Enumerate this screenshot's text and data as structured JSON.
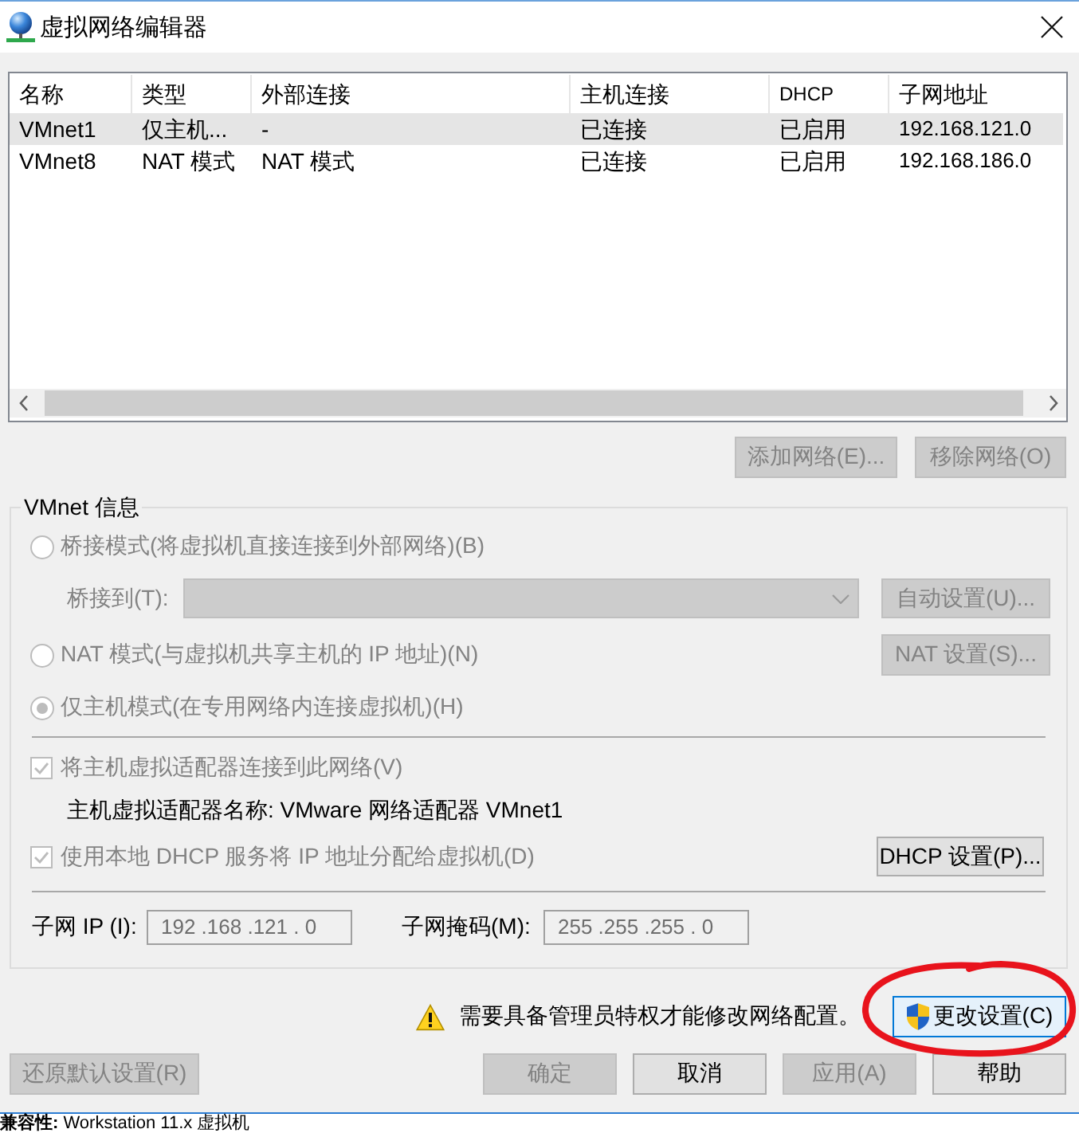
{
  "window": {
    "title": "虚拟网络编辑器"
  },
  "network_table": {
    "columns": [
      "名称",
      "类型",
      "外部连接",
      "主机连接",
      "DHCP",
      "子网地址"
    ],
    "rows": [
      {
        "cells": [
          "VMnet1",
          "仅主机...",
          "-",
          "已连接",
          "已启用",
          "192.168.121.0"
        ],
        "selected": true
      },
      {
        "cells": [
          "VMnet8",
          "NAT 模式",
          "NAT 模式",
          "已连接",
          "已启用",
          "192.168.186.0"
        ],
        "selected": false
      }
    ]
  },
  "table_buttons": [
    {
      "label": "添加网络(E)...",
      "disabled": true
    },
    {
      "label": "移除网络(O)",
      "disabled": true
    }
  ],
  "vmnet_info": {
    "title": "VMnet 信息",
    "modes": [
      {
        "label": "桥接模式(将虚拟机直接连接到外部网络)(B)",
        "selected": false,
        "disabled": true,
        "bridge_to": {
          "label": "桥接到(T):",
          "disabled": true,
          "button": {
            "label": "自动设置(U)...",
            "disabled": true
          }
        }
      },
      {
        "label": "NAT 模式(与虚拟机共享主机的 IP 地址)(N)",
        "selected": false,
        "disabled": true,
        "button": {
          "label": "NAT 设置(S)...",
          "disabled": true
        }
      },
      {
        "label": "仅主机模式(在专用网络内连接虚拟机)(H)",
        "selected": true,
        "disabled": true
      }
    ],
    "connect_adapter": {
      "label": "将主机虚拟适配器连接到此网络(V)",
      "checked": true,
      "disabled": true
    },
    "adapter_name": "主机虚拟适配器名称: VMware 网络适配器 VMnet1",
    "use_dhcp": {
      "label": "使用本地 DHCP 服务将 IP 地址分配给虚拟机(D)",
      "checked": true,
      "disabled": true,
      "button": {
        "label": "DHCP 设置(P)...",
        "disabled": false
      }
    },
    "subnet_ip": {
      "label": "子网 IP (I):",
      "value": "192 .168 .121 . 0",
      "disabled": true
    },
    "subnet_mask": {
      "label": "子网掩码(M):",
      "value": "255 .255 .255 . 0",
      "disabled": true
    }
  },
  "admin_notice": {
    "text": "需要具备管理员特权才能修改网络配置。",
    "button": {
      "label": "更改设置(C)",
      "focused": true
    }
  },
  "footer": {
    "restore_button": {
      "label": "还原默认设置(R)",
      "disabled": true
    },
    "buttons": [
      {
        "label": "确定",
        "disabled": true
      },
      {
        "label": "取消",
        "disabled": false
      },
      {
        "label": "应用(A)",
        "disabled": true
      },
      {
        "label": "帮助",
        "disabled": false
      }
    ]
  },
  "background_window": {
    "status_text": "**兼容性:** Workstation 11.x 虚拟机"
  }
}
